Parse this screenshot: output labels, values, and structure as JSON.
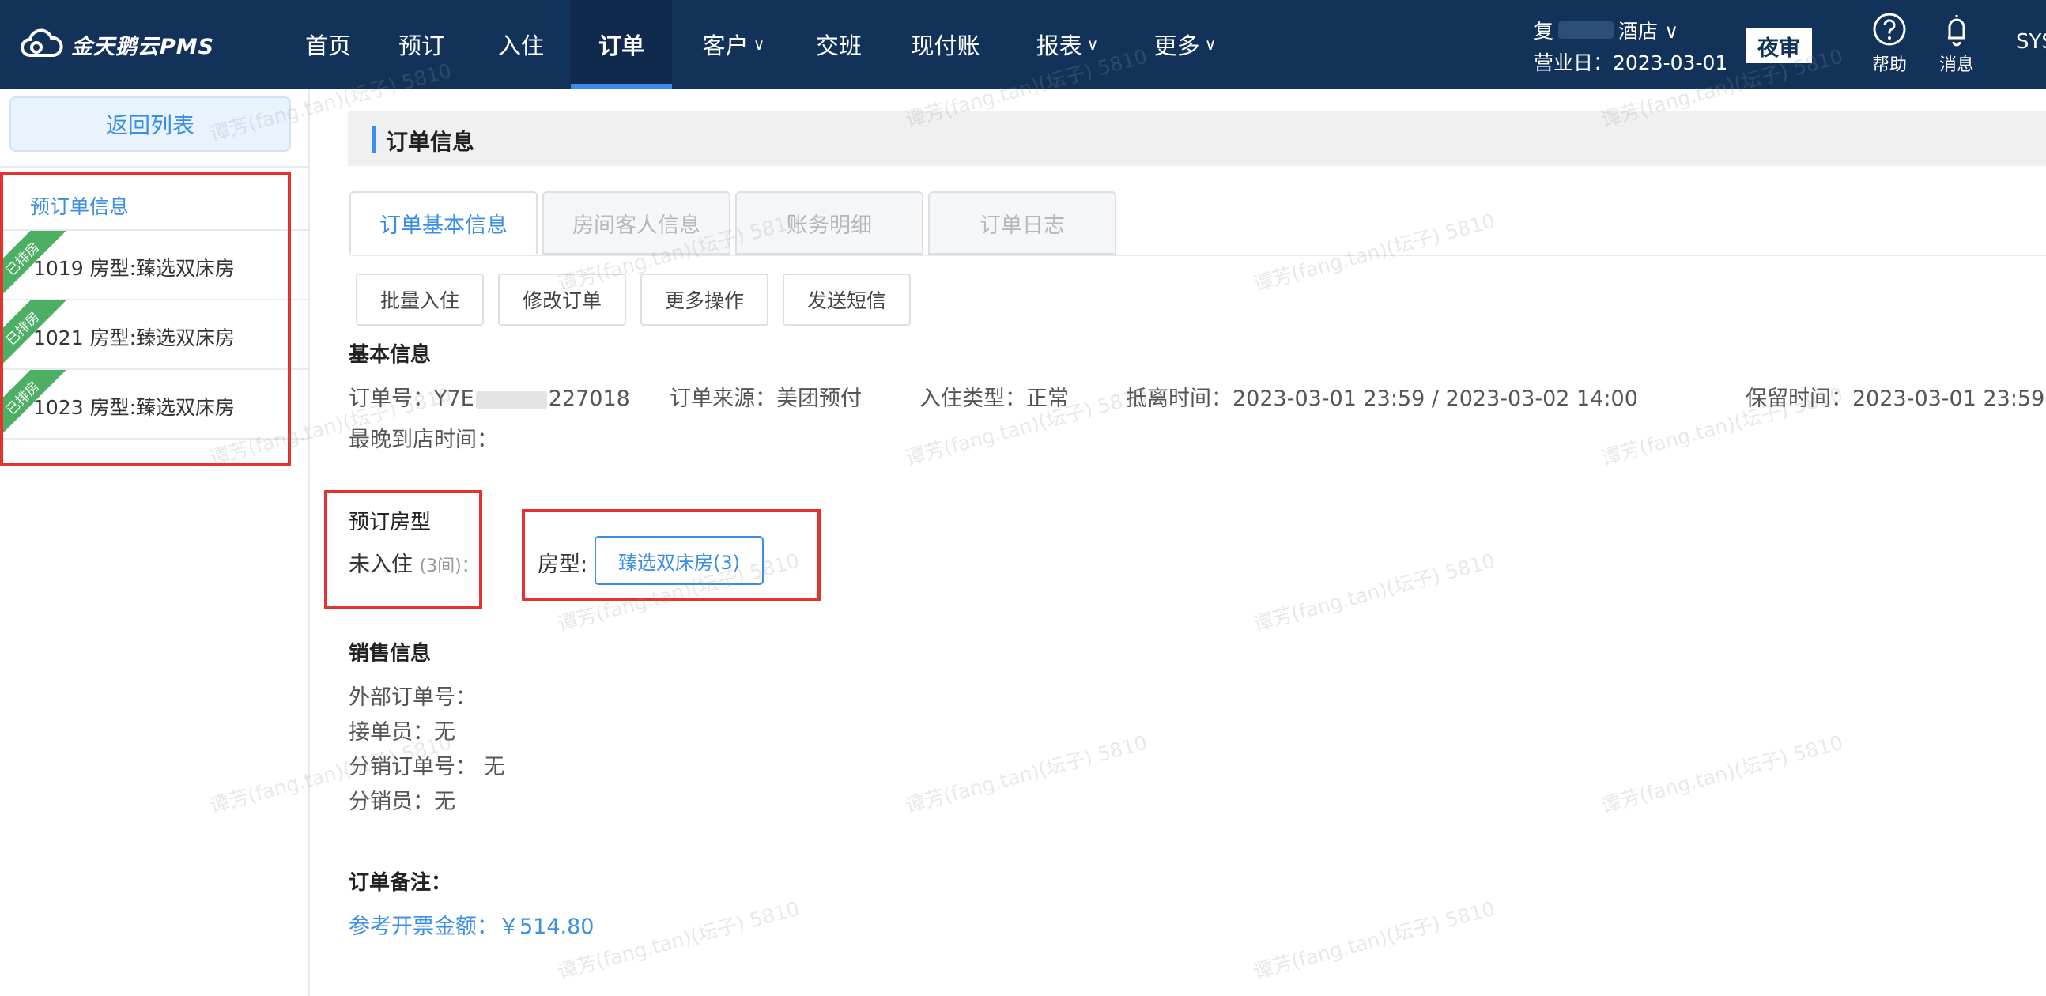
{
  "app": {
    "logo_text": "金天鹅云PMS"
  },
  "nav": {
    "items": [
      {
        "label": "首页",
        "caret": ""
      },
      {
        "label": "预订",
        "caret": ""
      },
      {
        "label": "入住",
        "caret": ""
      },
      {
        "label": "订单",
        "caret": ""
      },
      {
        "label": "客户",
        "caret": "∨"
      },
      {
        "label": "交班",
        "caret": ""
      },
      {
        "label": "现付账",
        "caret": ""
      },
      {
        "label": "报表",
        "caret": "∨"
      },
      {
        "label": "更多",
        "caret": "∨"
      }
    ],
    "active_index": 3
  },
  "header": {
    "hotel_prefix": "复",
    "hotel_suffix": "酒店 ∨",
    "business_date": "营业日：2023-03-01",
    "night_audit": "夜审",
    "help": "帮助",
    "messages": "消息",
    "user": "SYS"
  },
  "sidebar": {
    "back": "返回列表",
    "section_title": "预订单信息",
    "rooms": [
      {
        "badge": "已排房",
        "text": "1019  房型:臻选双床房"
      },
      {
        "badge": "已排房",
        "text": "1021  房型:臻选双床房"
      },
      {
        "badge": "已排房",
        "text": "1023  房型:臻选双床房"
      }
    ]
  },
  "main": {
    "section_title": "订单信息",
    "tabs": [
      "订单基本信息",
      "房间客人信息",
      "账务明细",
      "订单日志"
    ],
    "actions": [
      "批量入住",
      "修改订单",
      "更多操作",
      "发送短信"
    ],
    "basic": {
      "heading": "基本信息",
      "order_no_label": "订单号：",
      "order_no_prefix": "Y7E",
      "order_no_suffix": "227018",
      "source": "订单来源：美团预付",
      "checkin_type": "入住类型：正常",
      "arrive_leave": "抵离时间：2023-03-01 23:59 / 2023-03-02 14:00",
      "hold_time": "保留时间：2023-03-01 23:59",
      "latest_arrival": "最晚到店时间："
    },
    "booked_rooms": {
      "heading": "预订房型",
      "status": "未入住",
      "count": "(3间)",
      "colon": "：",
      "room_type_label": "房型:",
      "room_type_btn": "臻选双床房(3)"
    },
    "sales": {
      "heading": "销售信息",
      "external_no": "外部订单号：",
      "receiver": "接单员：无",
      "dist_no": "分销订单号：  无",
      "distributor": "分销员：无"
    },
    "remark": {
      "heading": "订单备注：",
      "invoice_amount": "参考开票金额：￥514.80"
    }
  },
  "watermark": "谭芳(fang.tan)(坛子) 5810"
}
